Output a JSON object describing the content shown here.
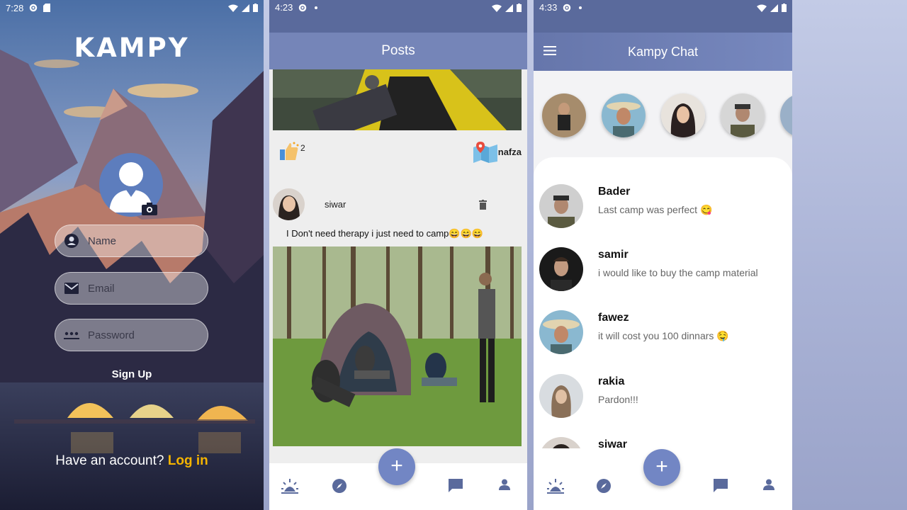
{
  "signup_screen": {
    "status_time": "7:28",
    "logo": "KAMPY",
    "fields": [
      {
        "placeholder": "Name",
        "icon": "account-circle-icon"
      },
      {
        "placeholder": "Email",
        "icon": "email-icon"
      },
      {
        "placeholder": "Password",
        "icon": "password-dots-icon"
      }
    ],
    "signup_label": "Sign Up",
    "have_account_text": "Have an account?",
    "login_label": "Log in"
  },
  "posts_screen": {
    "status_time": "4:23",
    "title": "Posts",
    "like_count": "2",
    "location": "nafza",
    "post": {
      "user": "siwar",
      "caption": "I Don't need therapy i just need to camp😄😄😄"
    },
    "fab_label": "+"
  },
  "chat_screen": {
    "status_time": "4:33",
    "title": "Kampy Chat",
    "conversations": [
      {
        "name": "Bader",
        "message": "Last camp was perfect 😋"
      },
      {
        "name": "samir",
        "message": "i would like to buy the camp material"
      },
      {
        "name": "fawez",
        "message": "it will cost you 100 dinnars 🤤"
      },
      {
        "name": "rakia",
        "message": "Pardon!!!"
      },
      {
        "name": "siwar",
        "message": ""
      }
    ],
    "fab_label": "+"
  },
  "colors": {
    "primary": "#7585b8",
    "accent_login": "#f5b400",
    "fab": "#7286c4"
  }
}
